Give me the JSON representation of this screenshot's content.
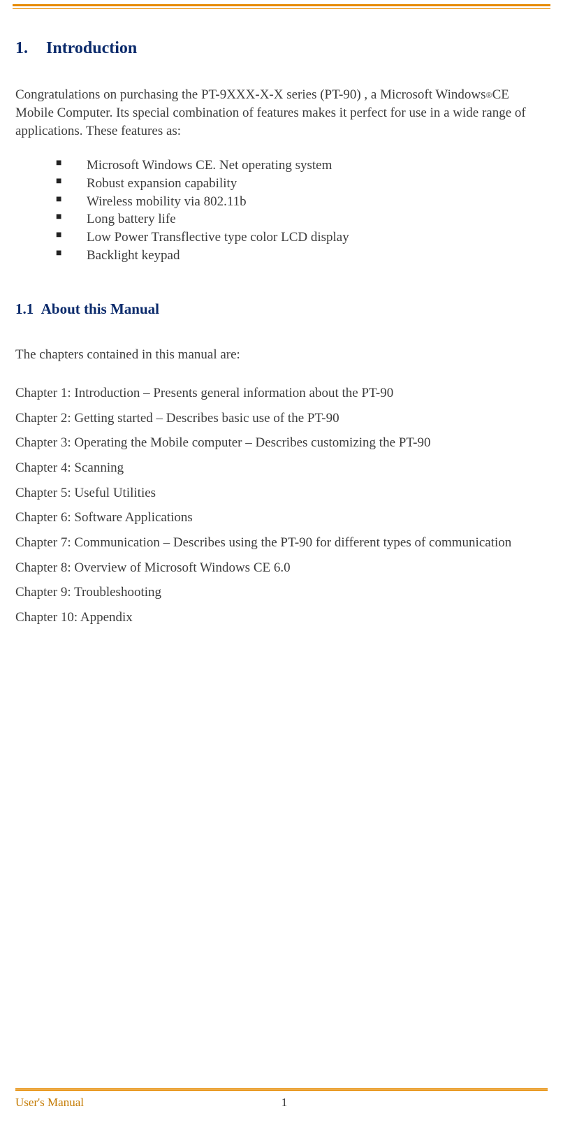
{
  "header": {
    "number": "1.",
    "title": "Introduction"
  },
  "intro": {
    "part1": "Congratulations on purchasing the PT-9XXX-X-X series (PT-90) , a Microsoft Windows",
    "reg": "®",
    "part2": "CE Mobile Computer. Its special combination of features makes it perfect for use in a wide range of applications. These features as:"
  },
  "features": [
    "Microsoft Windows CE. Net operating system",
    "Robust expansion capability",
    "Wireless mobility via 802.11b",
    "Long battery life",
    "Low Power Transflective type color LCD display",
    "Backlight keypad"
  ],
  "subsection": {
    "number": "1.1",
    "title": "About this Manual"
  },
  "lead": "The chapters contained in this manual are:",
  "chapters": [
    "Chapter 1: Introduction – Presents general information about the PT-90",
    "Chapter 2: Getting started – Describes basic use of the PT-90",
    "Chapter 3: Operating the Mobile computer – Describes customizing the PT-90",
    "Chapter 4: Scanning",
    "Chapter 5: Useful Utilities",
    "Chapter 6: Software Applications",
    "Chapter 7: Communication – Describes using the PT-90 for different types of communication",
    "Chapter 8: Overview of Microsoft Windows CE 6.0",
    "Chapter 9: Troubleshooting",
    "Chapter 10: Appendix"
  ],
  "footer": {
    "left": "User's Manual",
    "page": "1"
  }
}
